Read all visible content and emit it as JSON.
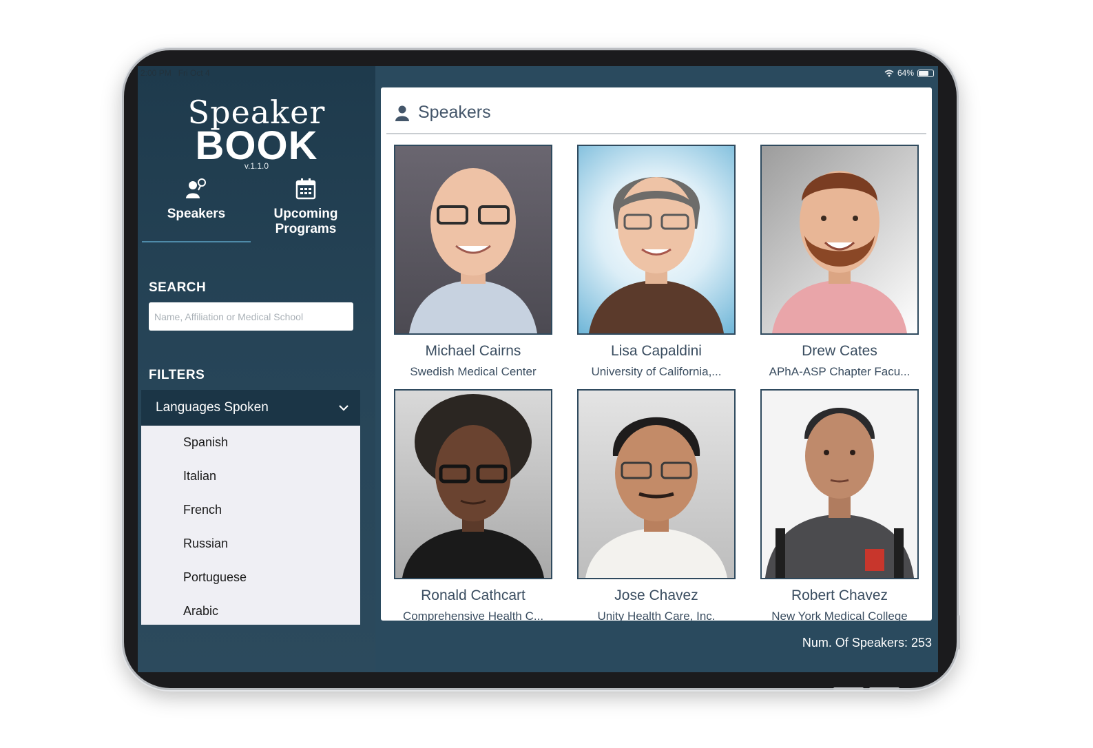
{
  "status_bar": {
    "time": "2:00 PM",
    "date": "Fri Oct 4",
    "battery": "64%"
  },
  "app": {
    "logo_top": "Speaker",
    "logo_bottom": "BOOK",
    "version": "v.1.1.0"
  },
  "nav": {
    "speakers_label": "Speakers",
    "programs_line1": "Upcoming",
    "programs_line2": "Programs"
  },
  "search": {
    "label": "SEARCH",
    "placeholder": "Name, Affiliation or Medical School"
  },
  "filters": {
    "label": "FILTERS",
    "header": "Languages Spoken",
    "options": [
      "Spanish",
      "Italian",
      "French",
      "Russian",
      "Portuguese",
      "Arabic"
    ]
  },
  "panel": {
    "title": "Speakers"
  },
  "speakers": [
    {
      "name": "Michael Cairns",
      "affiliation": "Swedish Medical Center"
    },
    {
      "name": "Lisa Capaldini",
      "affiliation": "University of California,..."
    },
    {
      "name": "Drew Cates",
      "affiliation": "APhA-ASP Chapter Facu..."
    },
    {
      "name": "Ronald Cathcart",
      "affiliation": "Comprehensive Health C..."
    },
    {
      "name": "Jose Chavez",
      "affiliation": "Unity Health Care, Inc."
    },
    {
      "name": "Robert Chavez",
      "affiliation": "New York Medical College"
    }
  ],
  "footer": {
    "count_text": "Num. Of Speakers: 253"
  },
  "colors": {
    "accent": "#2a4a5e",
    "sidebar": "#1e3a4c",
    "filter_header": "#1b3546",
    "text": "#3a4d60"
  }
}
